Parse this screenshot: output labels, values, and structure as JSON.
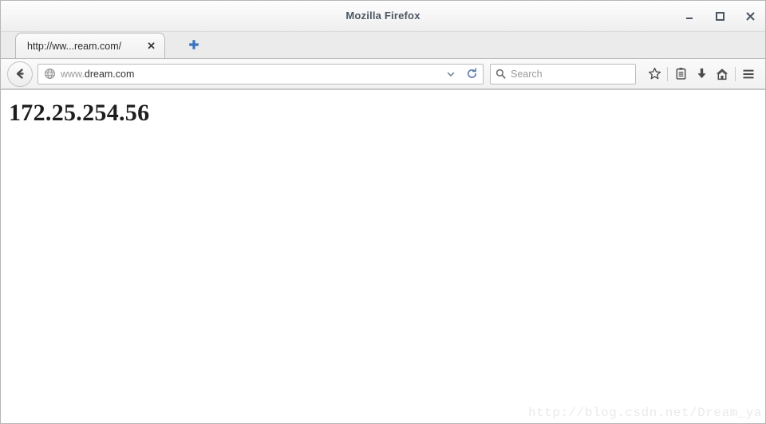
{
  "window": {
    "title": "Mozilla Firefox",
    "controls": [
      {
        "name": "minimize",
        "glyph": "_"
      },
      {
        "name": "maximize",
        "glyph": "□"
      },
      {
        "name": "close",
        "glyph": "✕"
      }
    ]
  },
  "tabs": {
    "items": [
      {
        "label": "http://ww...ream.com/",
        "close_label": "✕",
        "active": true
      }
    ],
    "new_tab_label": "+"
  },
  "navbar": {
    "back_label": "Back",
    "url_scheme_prefix": "www.",
    "url_domain": "dream.com",
    "url_full": "www.dream.com",
    "dropdown_label": "∨",
    "reload_label": "Reload",
    "search": {
      "value": "",
      "placeholder": "Search"
    },
    "buttons": [
      {
        "name": "bookmark-star",
        "label": "Bookmark this page"
      },
      {
        "name": "reader-list",
        "label": "Show your bookmarks"
      },
      {
        "name": "downloads",
        "label": "Downloads"
      },
      {
        "name": "home",
        "label": "Home"
      },
      {
        "name": "menu",
        "label": "Open menu"
      }
    ]
  },
  "page": {
    "heading": "172.25.254.56",
    "watermark": "http://blog.csdn.net/Dream_ya"
  },
  "colors": {
    "titlebar_text": "#4c5763",
    "newtab_blue": "#3a74c0",
    "icon_gray": "#4b4b4b",
    "reload_blue": "#5a7ca8",
    "watermark_gray": "#eaeaea",
    "page_text": "#1d1d1d"
  }
}
